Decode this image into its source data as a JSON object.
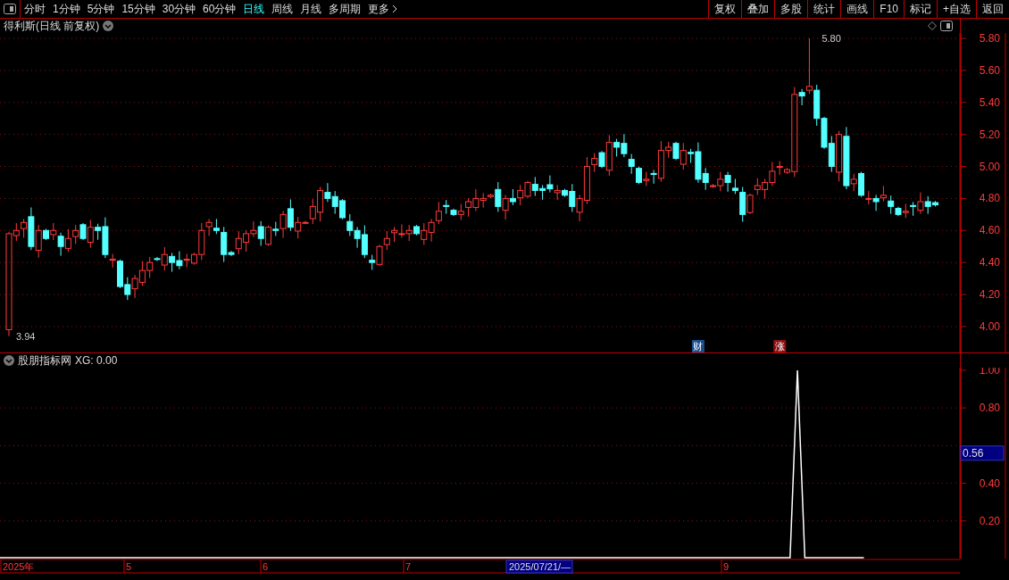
{
  "toolbar": {
    "periods": [
      {
        "label": "分时",
        "selected": false
      },
      {
        "label": "1分钟",
        "selected": false
      },
      {
        "label": "5分钟",
        "selected": false
      },
      {
        "label": "15分钟",
        "selected": false
      },
      {
        "label": "30分钟",
        "selected": false
      },
      {
        "label": "60分钟",
        "selected": false
      },
      {
        "label": "日线",
        "selected": true
      },
      {
        "label": "周线",
        "selected": false
      },
      {
        "label": "月线",
        "selected": false
      },
      {
        "label": "多周期",
        "selected": false
      },
      {
        "label": "更多",
        "selected": false
      }
    ],
    "actions": [
      "复权",
      "叠加",
      "多股",
      "统计",
      "画线",
      "F10",
      "标记",
      "+自选",
      "返回"
    ]
  },
  "price_chart": {
    "title": "得利斯(日线 前复权)",
    "axis_labels": [
      "5.80",
      "5.60",
      "5.40",
      "5.20",
      "5.00",
      "4.80",
      "4.60",
      "4.40",
      "4.20",
      "4.00"
    ],
    "high_label": "5.80",
    "low_label": "3.94",
    "event_tags": [
      {
        "label": "财",
        "color": "#1a4f8f"
      },
      {
        "label": "涨",
        "color": "#8c1010"
      }
    ]
  },
  "indicator": {
    "title": "股朋指标网",
    "separator": ":",
    "latest_value": "0.00",
    "cursor_value": "0.56",
    "chart_data": {
      "type": "line",
      "grid": true,
      "ylim": [
        0,
        1.014
      ],
      "yticks": [
        {
          "value": 0.2,
          "label": "0.20"
        },
        {
          "value": 0.4,
          "label": "0.40"
        },
        {
          "value": 0.8,
          "label": "0.80"
        },
        {
          "value": 1.0,
          "label": "1.00"
        }
      ],
      "series": [
        {
          "name": "XG",
          "color": "#ffffff",
          "values": [
            0,
            0,
            0,
            0,
            0,
            0,
            0,
            0,
            0,
            0,
            0,
            0,
            0,
            0,
            0,
            0,
            0,
            0,
            0,
            0,
            0,
            0,
            0,
            0,
            0,
            0,
            0,
            0,
            0,
            0,
            0,
            0,
            0,
            0,
            0,
            0,
            0,
            0,
            0,
            0,
            0,
            0,
            0,
            0,
            0,
            0,
            0,
            0,
            0,
            0,
            0,
            0,
            0,
            0,
            0,
            0,
            0,
            0,
            0,
            0,
            0,
            0,
            0,
            0,
            0,
            0,
            0,
            0,
            0,
            0,
            0,
            0,
            0,
            0,
            0,
            0,
            0,
            0,
            0,
            0,
            0,
            0,
            0,
            0,
            0,
            0,
            0,
            0,
            0,
            0,
            0,
            0,
            0,
            0,
            0,
            0,
            0,
            0,
            0,
            0,
            0,
            0,
            0,
            0,
            0,
            0,
            0,
            0,
            1,
            0,
            0,
            0,
            0,
            0,
            0,
            0,
            0,
            0,
            null,
            null,
            null,
            null,
            null,
            null,
            null,
            null,
            null,
            null,
            null,
            null,
            null
          ]
        }
      ]
    }
  },
  "time_axis": {
    "labels": [
      "2025年",
      "5",
      "6",
      "7",
      "9"
    ],
    "cursor_label": "2025/07/21/—"
  }
}
